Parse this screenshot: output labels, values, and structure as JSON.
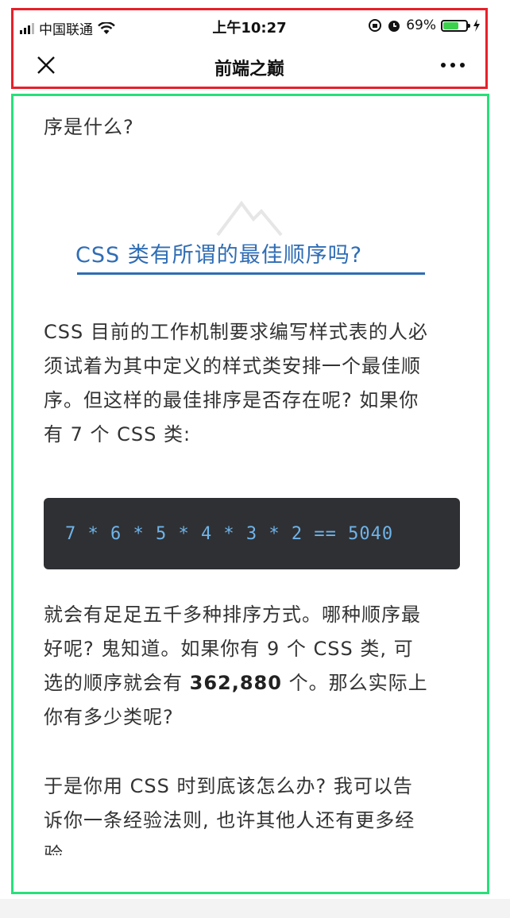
{
  "status_bar": {
    "carrier": "中国联通",
    "time": "上午10:27",
    "battery": "69%",
    "battery_level": 0.69,
    "battery_color": "#3bd14c"
  },
  "nav": {
    "title": "前端之巅",
    "close_icon": "close-icon",
    "more_icon": "more-icon"
  },
  "article": {
    "lead_text": "序是什么?",
    "heading": "CSS 类有所谓的最佳顺序吗?",
    "paragraph1_lines": [
      "CSS 目前的工作机制要求编写样式表的人必",
      "须试着为其中定义的样式类安排一个最佳顺",
      "序。但这样的最佳排序是否存在呢? 如果你",
      "有 7 个 CSS 类:"
    ],
    "code": "7 * 6 * 5 * 4 * 3 * 2 == 5040",
    "paragraph2": {
      "line1": "就会有足足五千多种排序方式。哪种顺序最",
      "line2": "好呢? 鬼知道。如果你有 9 个 CSS 类, 可",
      "line3_before": "选的顺序就会有 ",
      "line3_bold": "362,880",
      "line3_after": " 个。那么实际上",
      "line4": "你有多少类呢?"
    },
    "paragraph3_lines": [
      "于是你用 CSS 时到底该怎么办? 我可以告",
      "诉你一条经验法则, 也许其他人还有更多经",
      "验"
    ]
  },
  "colors": {
    "header_box": "#e8202a",
    "content_box": "#27e07a",
    "heading": "#2f6db5",
    "code_bg": "#2f3033",
    "code_text": "#6fb4ea"
  }
}
